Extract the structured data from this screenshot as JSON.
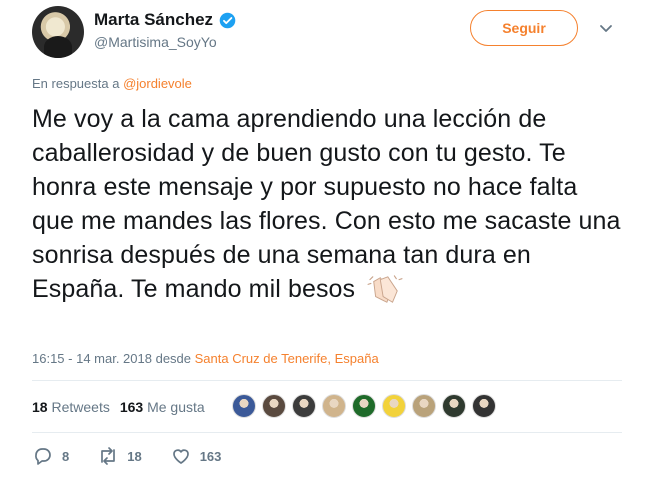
{
  "author": {
    "name": "Marta Sánchez",
    "handle": "@Martisima_SoyYo",
    "verified": true
  },
  "follow_button": {
    "label": "Seguir"
  },
  "reply": {
    "prefix": "En respuesta a ",
    "to": "@jordievole"
  },
  "tweet": {
    "text": "Me voy a la cama aprendiendo una lección de caballerosidad y de buen gusto con tu gesto. Te honra este mensaje y por supuesto no hace falta que me mandes las flores. Con esto me sacaste una sonrisa después de una semana tan dura en España. Te mando mil besos",
    "emoji": "clapping-hands-icon"
  },
  "meta": {
    "time": "16:15 - 14 mar. 2018 desde ",
    "location": "Santa Cruz de Tenerife, España"
  },
  "stats": {
    "retweets_count": "18",
    "retweets_label": "Retweets",
    "likes_count": "163",
    "likes_label": "Me gusta",
    "liker_colors": [
      "#3b5998",
      "#5a4a3f",
      "#3c3c3c",
      "#d0b48c",
      "#1f6b2a",
      "#f2d23b",
      "#b9a27a",
      "#2f3a2f",
      "#333333"
    ]
  },
  "actions": {
    "replies": "8",
    "retweets": "18",
    "likes": "163"
  },
  "colors": {
    "accent": "#f5812e",
    "muted": "#657786",
    "verified": "#1da1f2"
  }
}
